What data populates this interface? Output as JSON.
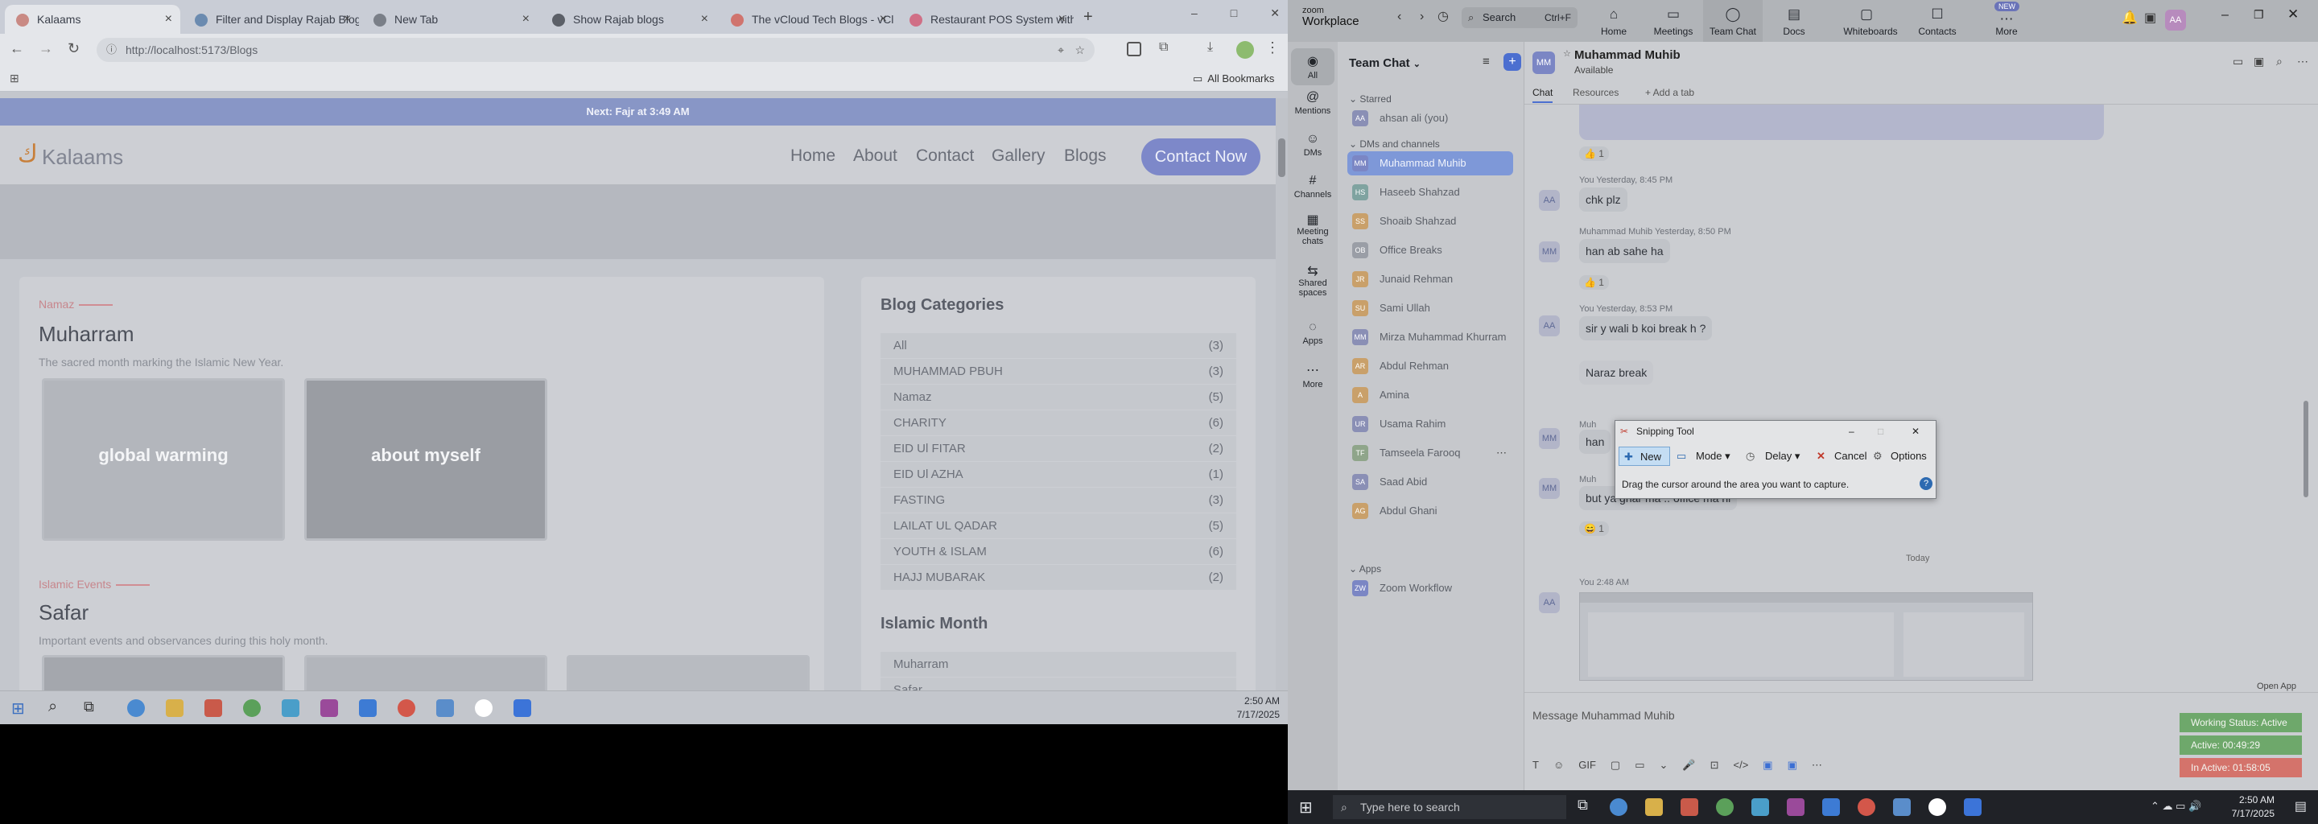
{
  "browser": {
    "tabs": [
      {
        "label": "Kalaams",
        "active": true,
        "icon_color": "#c98a84"
      },
      {
        "label": "Filter and Display Rajab Blogs",
        "active": false,
        "icon_color": "#6b8bb0"
      },
      {
        "label": "New Tab",
        "active": false,
        "icon_color": "#7a7f88"
      },
      {
        "label": "Show Rajab blogs",
        "active": false,
        "icon_color": "#5c6068"
      },
      {
        "label": "The vCloud Tech Blogs - vCl",
        "active": false,
        "icon_color": "#d0746e"
      },
      {
        "label": "Restaurant POS System with",
        "active": false,
        "icon_color": "#d06f86"
      }
    ],
    "new_tab_glyph": "+",
    "url": "http://localhost:5173/Blogs",
    "bookmarks_label": "All Bookmarks",
    "window_controls": [
      "–",
      "□",
      "✕"
    ]
  },
  "site": {
    "prayer_banner": "Next: Fajr at 3:49 AM",
    "logo": "Kalaams",
    "nav": [
      "Home",
      "About",
      "Contact",
      "Gallery",
      "Blogs"
    ],
    "contact_button": "Contact Now",
    "sections": [
      {
        "label": "Namaz",
        "title": "Muharram",
        "desc": "The sacred month marking the Islamic New Year.",
        "posts": [
          "global warming",
          "about myself"
        ]
      },
      {
        "label": "Islamic Events",
        "title": "Safar",
        "desc": "Important events and observances during this holy month."
      }
    ],
    "blog_categories_title": "Blog Categories",
    "categories": [
      {
        "name": "All",
        "count": "(3)"
      },
      {
        "name": "MUHAMMAD PBUH",
        "count": "(3)"
      },
      {
        "name": "Namaz",
        "count": "(5)"
      },
      {
        "name": "CHARITY",
        "count": "(6)"
      },
      {
        "name": "EID Ul FITAR",
        "count": "(2)"
      },
      {
        "name": "EID Ul AZHA",
        "count": "(1)"
      },
      {
        "name": "FASTING",
        "count": "(3)"
      },
      {
        "name": "LAILAT UL QADAR",
        "count": "(5)"
      },
      {
        "name": "YOUTH & ISLAM",
        "count": "(6)"
      },
      {
        "name": "HAJJ MUBARAK",
        "count": "(2)"
      }
    ],
    "islamic_month_title": "Islamic Month",
    "months": [
      "Muharram",
      "Safar"
    ]
  },
  "left_taskbar": {
    "time": "2:50 AM",
    "date": "7/17/2025"
  },
  "zoom": {
    "brand_top": "zoom",
    "brand": "Workplace",
    "search_label": "Search",
    "search_shortcut": "Ctrl+F",
    "top_nav": [
      {
        "label": "Home",
        "glyph": "⌂"
      },
      {
        "label": "Meetings",
        "glyph": "▭"
      },
      {
        "label": "Team Chat",
        "glyph": "◯"
      },
      {
        "label": "Docs",
        "glyph": "▤"
      },
      {
        "label": "Whiteboards",
        "glyph": "▢"
      },
      {
        "label": "Contacts",
        "glyph": "☐"
      },
      {
        "label": "More",
        "glyph": "⋯",
        "badge": "NEW"
      }
    ],
    "user_avatar": "AA",
    "rail": [
      {
        "label": "All",
        "glyph": "◉"
      },
      {
        "label": "Mentions",
        "glyph": "@"
      },
      {
        "label": "DMs",
        "glyph": "☺"
      },
      {
        "label": "Channels",
        "glyph": "#"
      },
      {
        "label": "Meeting chats",
        "glyph": "▦"
      },
      {
        "label": "Shared spaces",
        "glyph": "⇆"
      },
      {
        "label": "Apps",
        "glyph": "◌"
      },
      {
        "label": "More",
        "glyph": "⋯"
      }
    ],
    "panel_title": "Team Chat",
    "starred_label": "Starred",
    "starred": [
      {
        "name": "ahsan ali (you)",
        "initials": "AA",
        "color": "#8a8fb5"
      }
    ],
    "dms_label": "DMs and channels",
    "contacts": [
      {
        "name": "Muhammad Muhib",
        "initials": "MM",
        "color": "#7b86c4",
        "selected": true
      },
      {
        "name": "Haseeb Shahzad",
        "initials": "HS",
        "color": "#7fa3a0"
      },
      {
        "name": "Shoaib Shahzad",
        "initials": "SS",
        "color": "#c9a06a"
      },
      {
        "name": "Office Breaks",
        "initials": "OB",
        "color": "#9a9ea6"
      },
      {
        "name": "Junaid Rehman",
        "initials": "JR",
        "color": "#c9a06a"
      },
      {
        "name": "Sami Ullah",
        "initials": "SU",
        "color": "#c9a06a"
      },
      {
        "name": "Mirza Muhammad Khurram",
        "initials": "MM",
        "color": "#8a8fb5"
      },
      {
        "name": "Abdul Rehman",
        "initials": "AR",
        "color": "#c9a06a"
      },
      {
        "name": "Amina",
        "initials": "A",
        "color": "#c9a06a"
      },
      {
        "name": "Usama Rahim",
        "initials": "UR",
        "color": "#8a8fb5"
      },
      {
        "name": "Tamseela Farooq",
        "initials": "TF",
        "color": "#8fa58a"
      },
      {
        "name": "Saad Abid",
        "initials": "SA",
        "color": "#8a8fb5"
      },
      {
        "name": "Abdul Ghani",
        "initials": "AG",
        "color": "#c9a06a"
      }
    ],
    "apps_label": "Apps",
    "apps": [
      {
        "name": "Zoom Workflow",
        "initials": "ZW",
        "color": "#7b86c4"
      }
    ],
    "chat_with": "Muhammad Muhib",
    "chat_with_initials": "MM",
    "chat_status": "Available",
    "chat_tabs": [
      "Chat",
      "Resources",
      "+ Add a tab"
    ],
    "messages": [
      {
        "meta": "You Yesterday, 8:45 PM",
        "text": "chk plz",
        "avatar": "AA"
      },
      {
        "meta": "Muhammad Muhib Yesterday, 8:50 PM",
        "text": "han ab sahe ha",
        "avatar": "MM"
      },
      {
        "meta": "You Yesterday, 8:53 PM",
        "text": "sir y wali b koi break h ?",
        "avatar": "AA"
      },
      {
        "meta": "",
        "text": "Naraz break",
        "avatar": ""
      },
      {
        "meta": "Muh",
        "text": "han",
        "avatar": "MM"
      },
      {
        "meta": "Muh",
        "text": "but ya ghar ma .. office ma ni",
        "avatar": "MM"
      }
    ],
    "reactions": [
      "👍 1",
      "👍 1",
      "😄 1"
    ],
    "today_label": "Today",
    "last_meta": "You 2:48 AM",
    "composer_placeholder": "Message Muhammad Muhib",
    "composer_tools": [
      "T",
      "☺",
      "GIF",
      "▢",
      "▭",
      "⌄",
      "🎤",
      "⊡",
      "</>",
      "▣",
      "▣",
      "⋯"
    ],
    "open_app": "Open App"
  },
  "snipping_tool": {
    "title": "Snipping Tool",
    "buttons": [
      "New",
      "Mode",
      "Delay",
      "Cancel",
      "Options"
    ],
    "hint": "Drag the cursor around the area you want to capture."
  },
  "status_pills": [
    {
      "text": "Working Status: Active",
      "color": "#6ea86b"
    },
    {
      "text": "Active: 00:49:29",
      "color": "#6ea86b"
    },
    {
      "text": "In Active: 01:58:05",
      "color": "#d4736b"
    }
  ],
  "right_taskbar": {
    "search_placeholder": "Type here to search",
    "time": "2:50 AM",
    "date": "7/17/2025"
  }
}
